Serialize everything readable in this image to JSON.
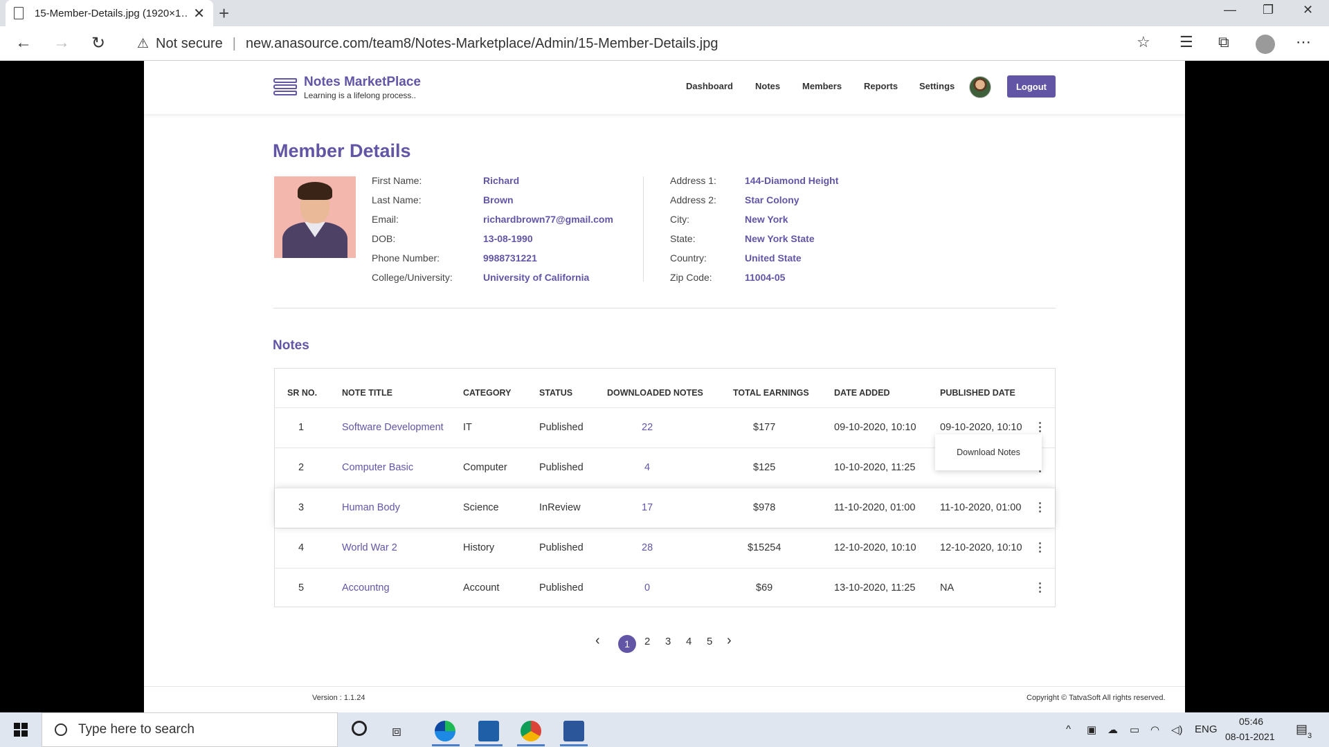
{
  "browser": {
    "tab_title": "15-Member-Details.jpg (1920×1…",
    "security": "Not secure",
    "url": "new.anasource.com/team8/Notes-Marketplace/Admin/15-Member-Details.jpg"
  },
  "header": {
    "brand": "Notes MarketPlace",
    "tagline": "Learning is a lifelong process..",
    "nav": [
      "Dashboard",
      "Notes",
      "Members",
      "Reports",
      "Settings"
    ],
    "logout": "Logout"
  },
  "member": {
    "page_title": "Member Details",
    "left": [
      {
        "label": "First Name:",
        "value": "Richard"
      },
      {
        "label": "Last Name:",
        "value": "Brown"
      },
      {
        "label": "Email:",
        "value": "richardbrown77@gmail.com"
      },
      {
        "label": "DOB:",
        "value": "13-08-1990"
      },
      {
        "label": "Phone Number:",
        "value": "9988731221"
      },
      {
        "label": "College/University:",
        "value": "University of California"
      }
    ],
    "right": [
      {
        "label": "Address 1:",
        "value": "144-Diamond Height"
      },
      {
        "label": "Address 2:",
        "value": "Star Colony"
      },
      {
        "label": "City:",
        "value": "New York"
      },
      {
        "label": "State:",
        "value": "New York State"
      },
      {
        "label": "Country:",
        "value": "United State"
      },
      {
        "label": "Zip Code:",
        "value": "11004-05"
      }
    ]
  },
  "notes": {
    "title": "Notes",
    "columns": [
      "SR NO.",
      "NOTE TITLE",
      "CATEGORY",
      "STATUS",
      "DOWNLOADED NOTES",
      "TOTAL EARNINGS",
      "DATE ADDED",
      "PUBLISHED DATE"
    ],
    "rows": [
      {
        "sr": "1",
        "title": "Software Development",
        "category": "IT",
        "status": "Published",
        "downloads": "22",
        "earnings": "$177",
        "added": "09-10-2020, 10:10",
        "published": "09-10-2020, 10:10"
      },
      {
        "sr": "2",
        "title": "Computer Basic",
        "category": "Computer",
        "status": "Published",
        "downloads": "4",
        "earnings": "$125",
        "added": "10-10-2020, 11:25",
        "published": ""
      },
      {
        "sr": "3",
        "title": "Human Body",
        "category": "Science",
        "status": "InReview",
        "downloads": "17",
        "earnings": "$978",
        "added": "11-10-2020, 01:00",
        "published": "11-10-2020, 01:00"
      },
      {
        "sr": "4",
        "title": "World War 2",
        "category": "History",
        "status": "Published",
        "downloads": "28",
        "earnings": "$15254",
        "added": "12-10-2020, 10:10",
        "published": "12-10-2020, 10:10"
      },
      {
        "sr": "5",
        "title": "Accountng",
        "category": "Account",
        "status": "Published",
        "downloads": "0",
        "earnings": "$69",
        "added": "13-10-2020, 11:25",
        "published": "NA"
      }
    ],
    "dropdown_item": "Download Notes"
  },
  "pagination": {
    "prev": "‹",
    "pages": [
      "1",
      "2",
      "3",
      "4",
      "5"
    ],
    "next": "›",
    "current": "1"
  },
  "footer": {
    "version": "Version : 1.1.24",
    "copyright": "Copyright © TatvaSoft All rights reserved."
  },
  "taskbar": {
    "search_placeholder": "Type here to search",
    "lang": "ENG",
    "time": "05:46",
    "date": "08-01-2021",
    "notification_count": "3"
  },
  "colors": {
    "brand": "#6255a5"
  }
}
